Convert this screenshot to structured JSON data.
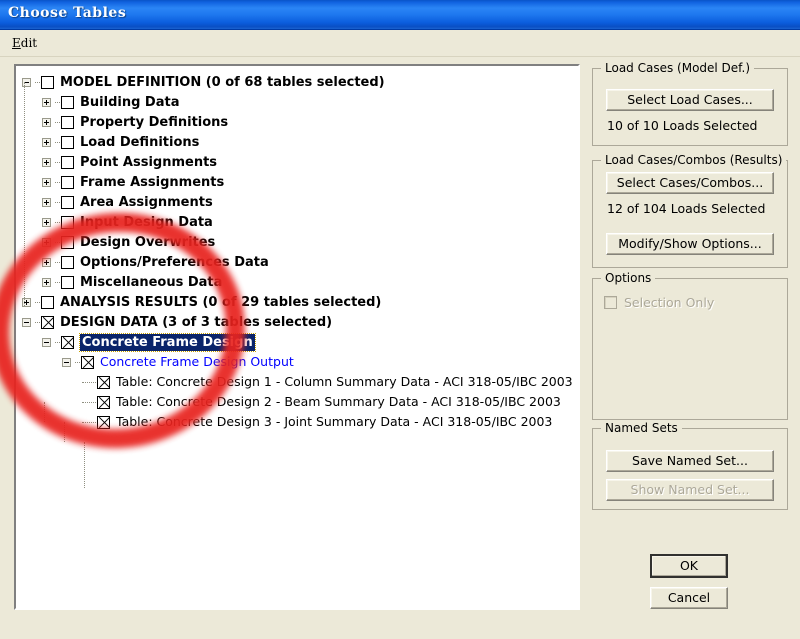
{
  "window": {
    "title": "Choose Tables"
  },
  "menubar": {
    "items": [
      {
        "label": "Edit",
        "accel": "E"
      }
    ]
  },
  "tree": {
    "nodes": [
      {
        "level": 0,
        "expander": "minus",
        "checkbox": "unchecked",
        "label": "MODEL DEFINITION  (0 of 68 tables selected)",
        "style": "bold"
      },
      {
        "level": 1,
        "expander": "plus",
        "checkbox": "unchecked",
        "label": "Building Data",
        "style": "bold"
      },
      {
        "level": 1,
        "expander": "plus",
        "checkbox": "unchecked",
        "label": "Property Definitions",
        "style": "bold"
      },
      {
        "level": 1,
        "expander": "plus",
        "checkbox": "unchecked",
        "label": "Load Definitions",
        "style": "bold"
      },
      {
        "level": 1,
        "expander": "plus",
        "checkbox": "unchecked",
        "label": "Point Assignments",
        "style": "bold"
      },
      {
        "level": 1,
        "expander": "plus",
        "checkbox": "unchecked",
        "label": "Frame Assignments",
        "style": "bold"
      },
      {
        "level": 1,
        "expander": "plus",
        "checkbox": "unchecked",
        "label": "Area Assignments",
        "style": "bold"
      },
      {
        "level": 1,
        "expander": "plus",
        "checkbox": "unchecked",
        "label": "Input Design Data",
        "style": "bold"
      },
      {
        "level": 1,
        "expander": "plus",
        "checkbox": "unchecked",
        "label": "Design Overwrites",
        "style": "bold"
      },
      {
        "level": 1,
        "expander": "plus",
        "checkbox": "unchecked",
        "label": "Options/Preferences Data",
        "style": "bold"
      },
      {
        "level": 1,
        "expander": "plus",
        "checkbox": "unchecked",
        "label": "Miscellaneous Data",
        "style": "bold"
      },
      {
        "level": 0,
        "expander": "plus",
        "checkbox": "unchecked",
        "label": "ANALYSIS RESULTS  (0 of 29 tables selected)",
        "style": "bold"
      },
      {
        "level": 0,
        "expander": "minus",
        "checkbox": "checked",
        "label": "DESIGN DATA  (3 of 3 tables selected)",
        "style": "bold"
      },
      {
        "level": 1,
        "expander": "minus",
        "checkbox": "checked",
        "label": "Concrete Frame Design",
        "style": "selected"
      },
      {
        "level": 2,
        "expander": "minus",
        "checkbox": "checked",
        "label": "Concrete Frame Design Output",
        "style": "blue"
      },
      {
        "level": 3,
        "expander": "none",
        "checkbox": "checked",
        "label": "Table:  Concrete Design 1 - Column Summary Data - ACI 318-05/IBC 2003",
        "style": "normal"
      },
      {
        "level": 3,
        "expander": "none",
        "checkbox": "checked",
        "label": "Table:  Concrete Design 2 - Beam Summary Data - ACI 318-05/IBC 2003",
        "style": "normal"
      },
      {
        "level": 3,
        "expander": "none",
        "checkbox": "checked",
        "label": "Table:  Concrete Design 3 - Joint Summary Data - ACI 318-05/IBC 2003",
        "style": "normal"
      }
    ]
  },
  "panels": {
    "load_cases_model": {
      "title": "Load Cases (Model Def.)",
      "select_button": "Select Load Cases...",
      "status": "10  of  10  Loads Selected"
    },
    "load_cases_results": {
      "title": "Load Cases/Combos (Results)",
      "select_button": "Select Cases/Combos...",
      "status": "12  of  104  Loads Selected",
      "modify_button": "Modify/Show Options..."
    },
    "options": {
      "title": "Options",
      "selection_only_label": "Selection Only",
      "selection_only_checked": false,
      "selection_only_enabled": false
    },
    "named_sets": {
      "title": "Named Sets",
      "save_button": "Save Named Set...",
      "show_button": "Show Named Set...",
      "show_button_enabled": false
    }
  },
  "dialog_buttons": {
    "ok": "OK",
    "cancel": "Cancel"
  },
  "annotation": {
    "type": "red-ellipse-highlight",
    "color": "#e8231f"
  }
}
